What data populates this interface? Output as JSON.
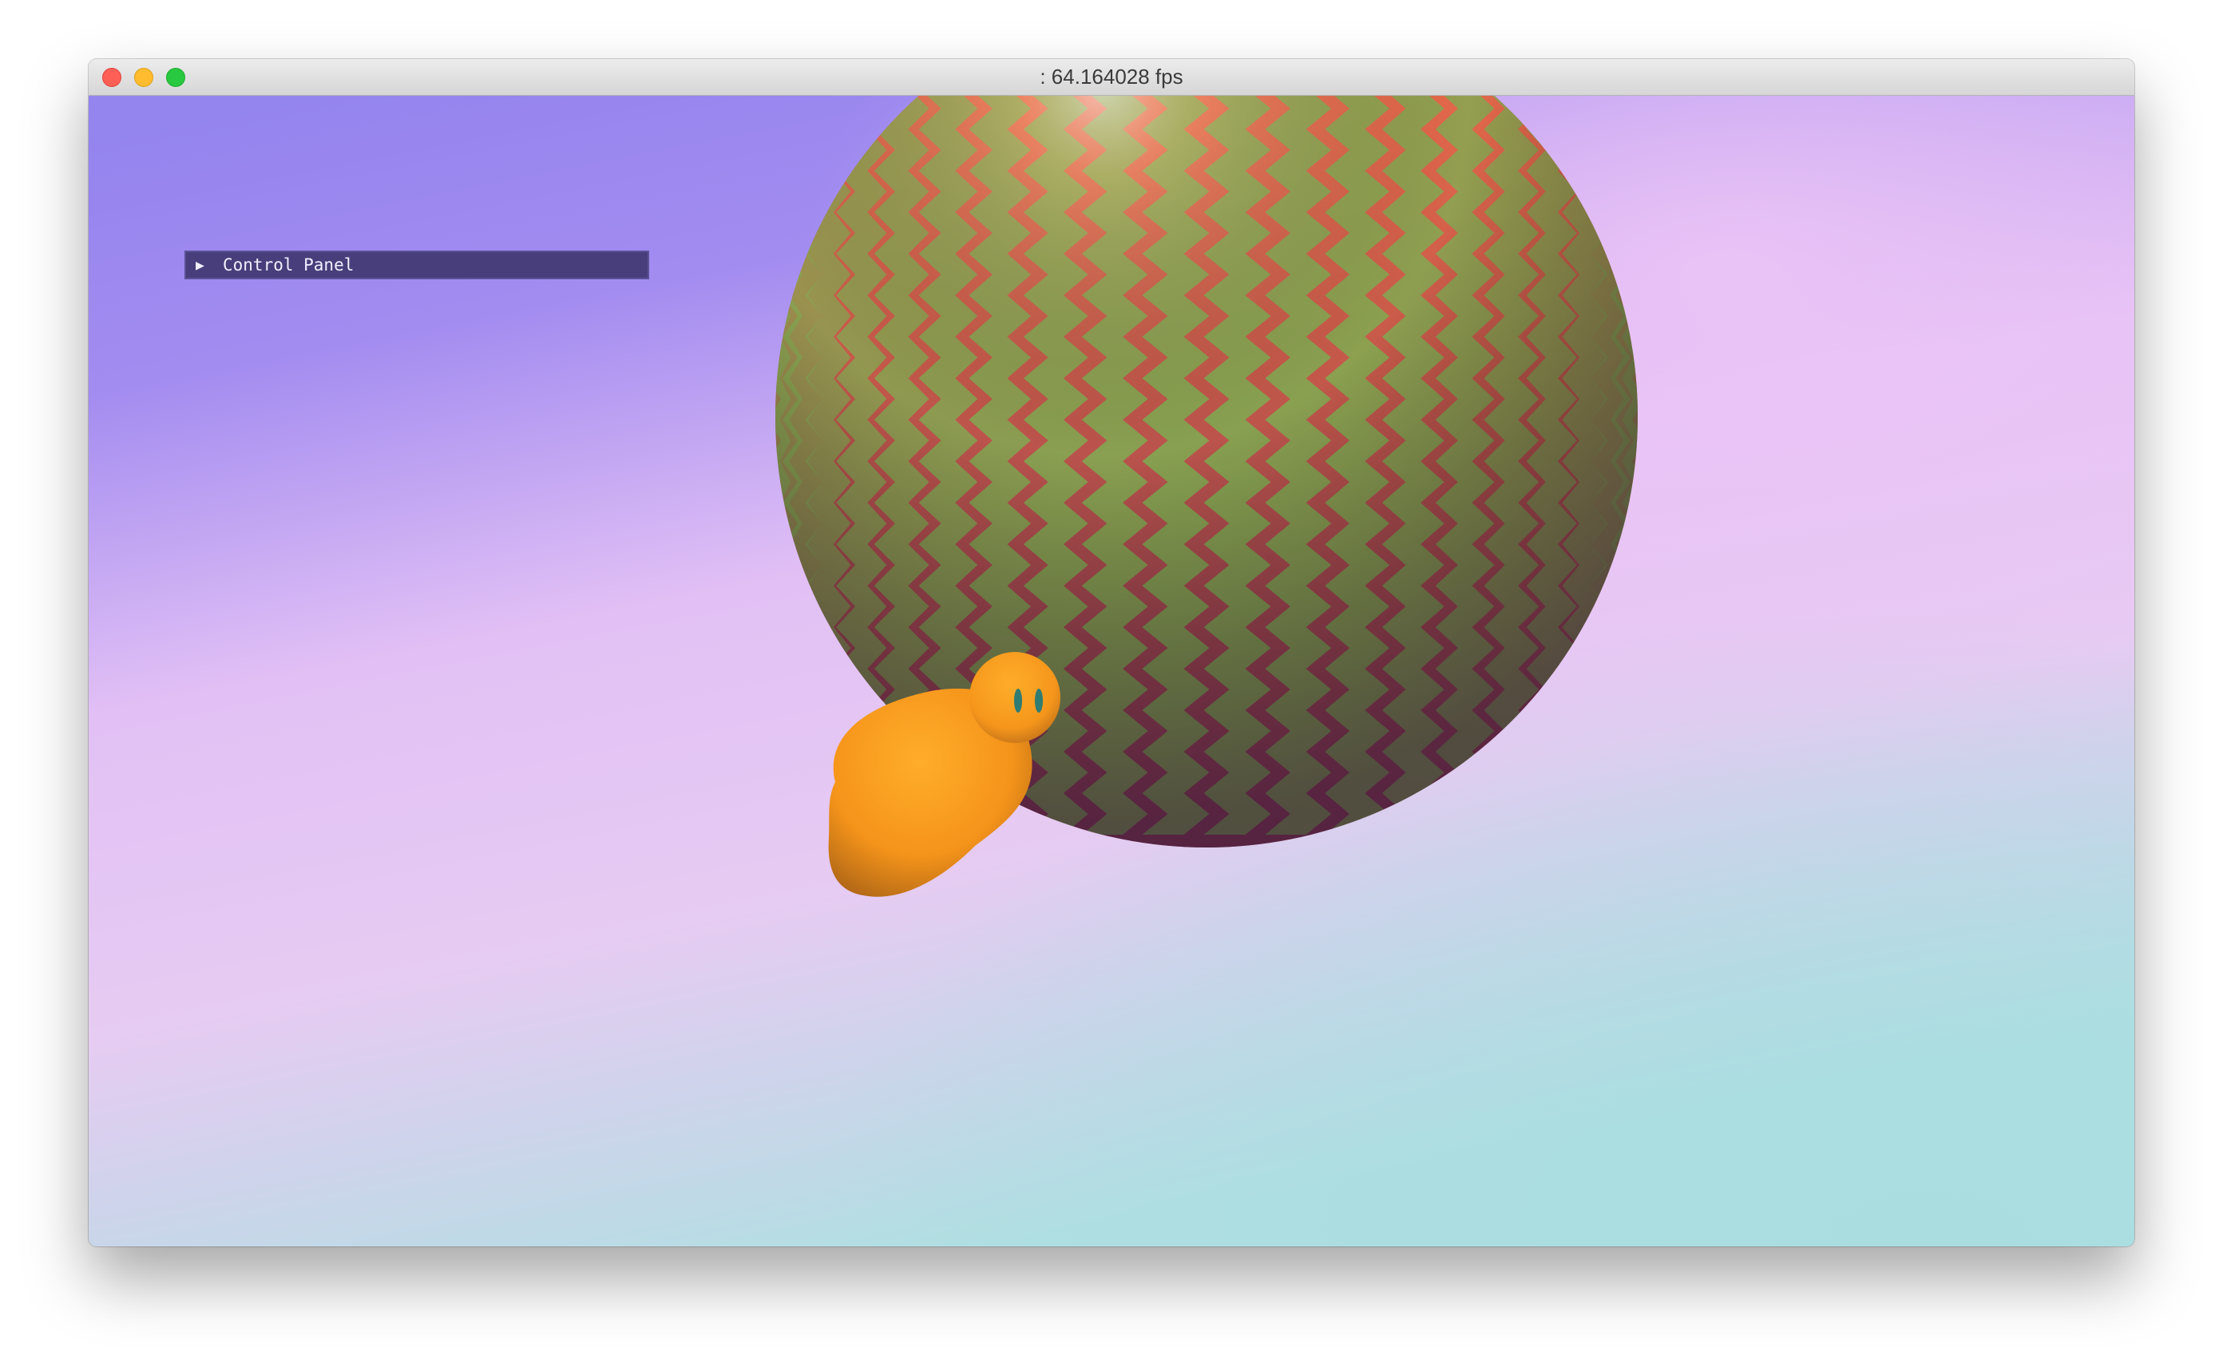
{
  "window": {
    "title": ": 64.164028 fps",
    "buttons": [
      "close",
      "minimize",
      "maximize"
    ]
  },
  "control_panel": {
    "label": "Control Panel",
    "expand_icon": "triangle-right-icon",
    "collapsed": true
  },
  "scene": {
    "objects": [
      "striped-sphere",
      "orange-creature"
    ],
    "colors": {
      "sky_top": "#9585ee",
      "sky_mid": "#e4c4f4",
      "sky_bottom": "#b0dfe2",
      "sphere_red": "#e8584a",
      "sphere_green": "#7fae52",
      "creature": "#f49a1c",
      "eyes": "#2f7c72"
    }
  }
}
